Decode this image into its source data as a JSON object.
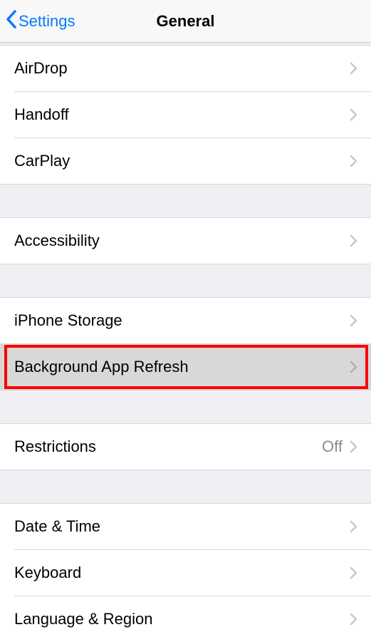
{
  "nav": {
    "back_label": "Settings",
    "title": "General"
  },
  "groups": [
    {
      "rows": [
        {
          "label": "AirDrop",
          "value": ""
        },
        {
          "label": "Handoff",
          "value": ""
        },
        {
          "label": "CarPlay",
          "value": ""
        }
      ]
    },
    {
      "rows": [
        {
          "label": "Accessibility",
          "value": ""
        }
      ]
    },
    {
      "rows": [
        {
          "label": "iPhone Storage",
          "value": ""
        },
        {
          "label": "Background App Refresh",
          "value": "",
          "highlighted": true
        }
      ]
    },
    {
      "rows": [
        {
          "label": "Restrictions",
          "value": "Off"
        }
      ]
    },
    {
      "rows": [
        {
          "label": "Date & Time",
          "value": ""
        },
        {
          "label": "Keyboard",
          "value": ""
        },
        {
          "label": "Language & Region",
          "value": ""
        }
      ]
    }
  ]
}
